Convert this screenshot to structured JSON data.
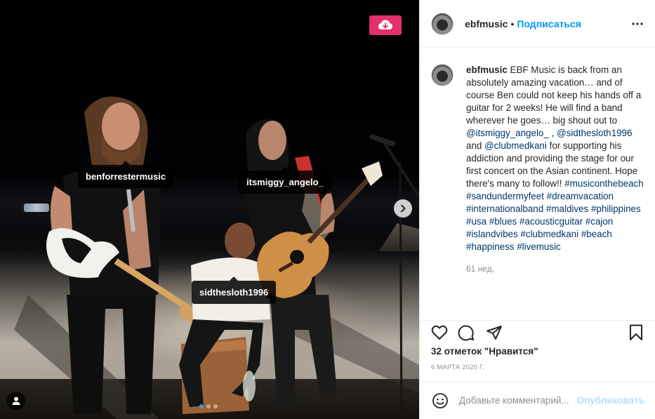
{
  "photo": {
    "tags": [
      {
        "username": "benforrestermusic"
      },
      {
        "username": "itsmiggy_angelo_"
      },
      {
        "username": "sidthesloth1996"
      }
    ],
    "carousel_dots": 3,
    "carousel_active": 0,
    "save_icon": "cloud-download-icon",
    "next_icon": "chevron-right-icon",
    "user_tags_icon": "user-icon"
  },
  "header": {
    "username": "ebfmusic",
    "separator": "•",
    "follow_label": "Подписаться",
    "more_icon": "more-horizontal-icon"
  },
  "caption": {
    "username": "ebfmusic",
    "text_1": "EBF Music is back from an absolutely amazing vacation… and of course Ben could not keep his hands off a guitar for 2 weeks! He will find a band wherever he goes… big shout out to",
    "mention_1": "@itsmiggy_angelo_",
    "text_2": ",",
    "mention_2": "@sidthesloth1996",
    "text_3": "and",
    "mention_3": "@clubmedkani",
    "text_4": "for supporting his addiction and providing the stage for our first concert on the Asian continent. Hope there's many to follow!!",
    "hashtags": [
      "#musiconthebeach",
      "#sandundermyfeet",
      "#dreamvacation",
      "#internationalband",
      "#maldives",
      "#philippines",
      "#usa",
      "#blues",
      "#acousticguitar",
      "#cajon",
      "#islandvibes",
      "#clubmedkani",
      "#beach",
      "#happiness",
      "#livemusic"
    ],
    "time_ago": "61 нед."
  },
  "actions": {
    "like_icon": "heart-icon",
    "comment_icon": "comment-icon",
    "share_icon": "share-icon",
    "save_icon": "bookmark-icon"
  },
  "likes_text": "32 отметок \"Нравится\"",
  "post_date": "6 марта 2020 г.",
  "comment_bar": {
    "emoji_icon": "emoji-icon",
    "placeholder": "Добавьте комментарий...",
    "post_label": "Опубликовать"
  },
  "colors": {
    "brand_pink": "#e1306c",
    "link_blue": "#0095f6",
    "mention_blue": "#00376b",
    "muted": "#8e8e8e"
  }
}
